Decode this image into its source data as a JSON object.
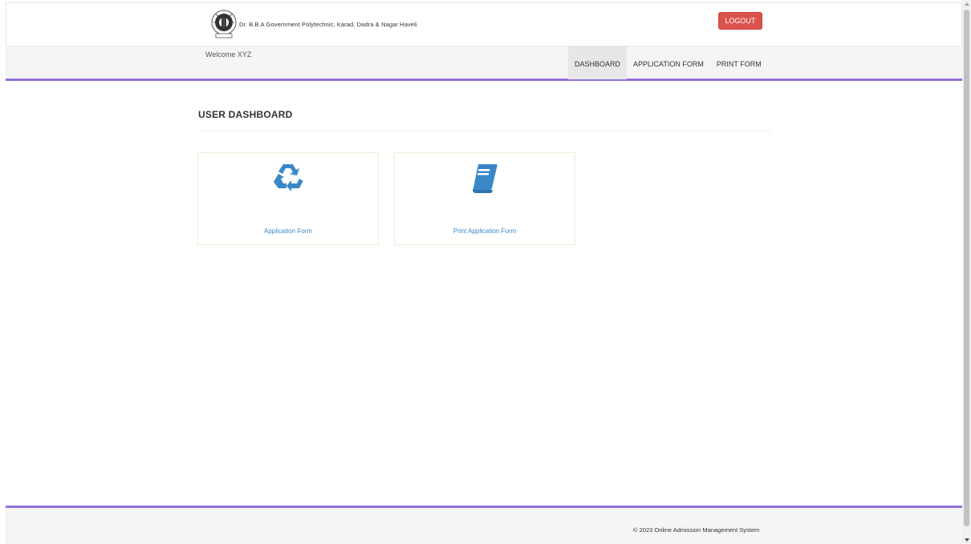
{
  "header": {
    "institute_name": "Dr. B.B.A Government Polytechnic, Karad, Dadra & Nagar Haveli",
    "logout_label": "LOGOUT"
  },
  "nav": {
    "welcome_text": "Welcome XYZ",
    "items": [
      {
        "label": "DASHBOARD",
        "active": true
      },
      {
        "label": "APPLICATION FORM",
        "active": false
      },
      {
        "label": "PRINT FORM",
        "active": false
      }
    ]
  },
  "main": {
    "heading": "USER DASHBOARD",
    "cards": [
      {
        "icon": "recycle-icon",
        "label": "Application Form"
      },
      {
        "icon": "book-icon",
        "label": "Print Application Form"
      }
    ]
  },
  "footer": {
    "copyright": "© 2023 Online Admission Management System"
  },
  "colors": {
    "accent": "#9370db",
    "logout": "#d9534f",
    "icon_blue": "#3a87c8",
    "link_blue": "#3a87c8"
  }
}
